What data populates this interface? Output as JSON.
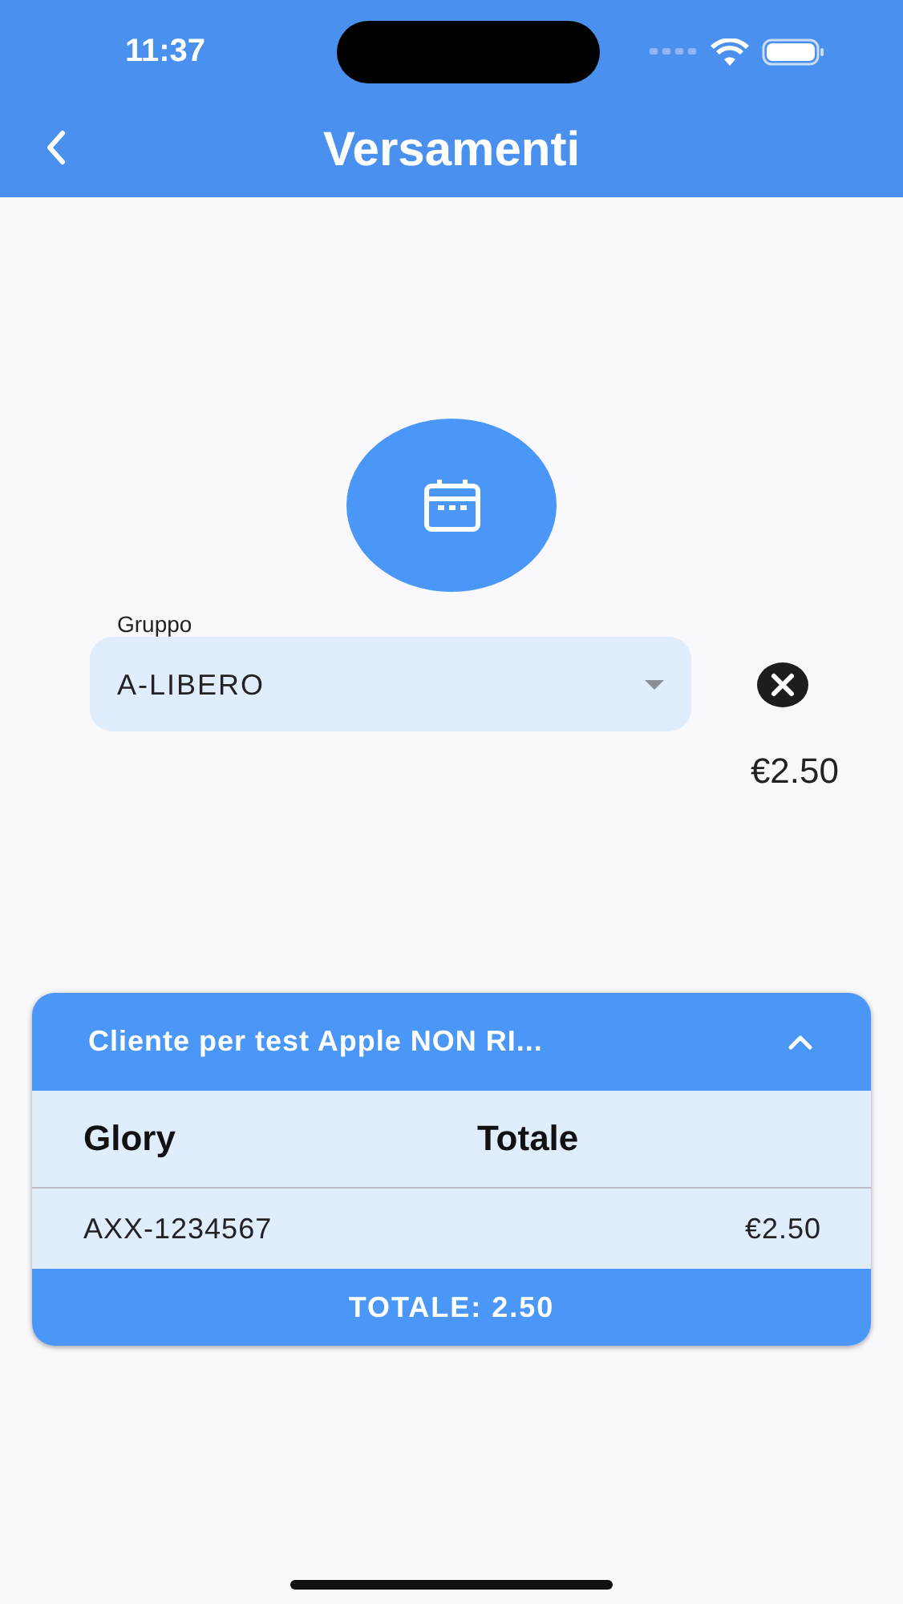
{
  "status_bar": {
    "time": "11:37"
  },
  "nav": {
    "title": "Versamenti"
  },
  "group_field": {
    "label": "Gruppo",
    "value": "A-LIBERO"
  },
  "amount": "€2.50",
  "card": {
    "title": "Cliente per test Apple NON RI...",
    "expanded": true,
    "columns": [
      "Glory",
      "Totale"
    ],
    "rows": [
      {
        "code": "AXX-1234567",
        "total": "€2.50"
      }
    ],
    "footer": "TOTALE: 2.50"
  }
}
